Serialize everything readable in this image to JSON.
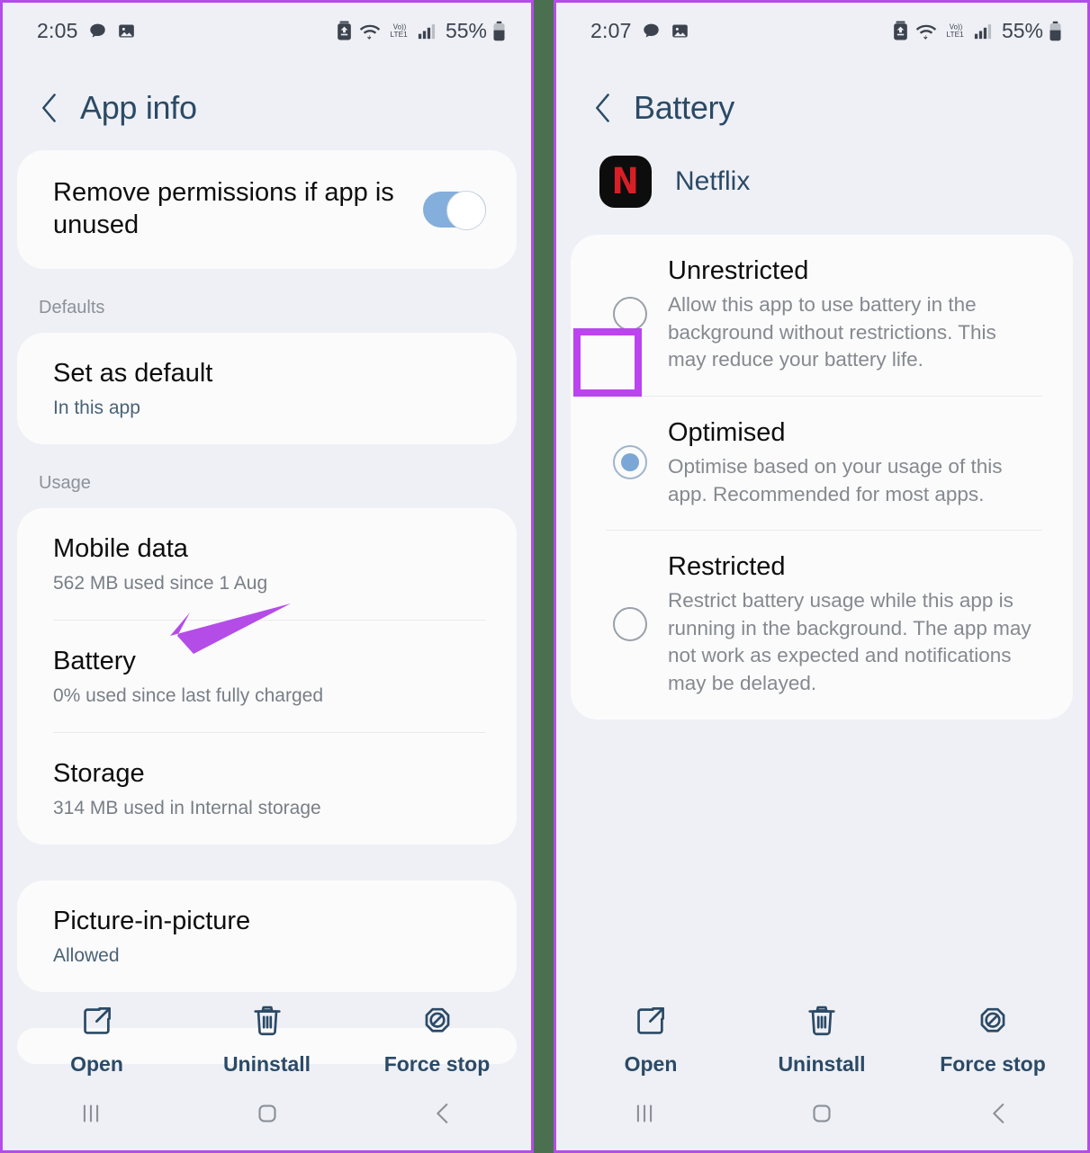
{
  "left_phone": {
    "status_bar": {
      "time": "2:05",
      "battery_percent": "55%",
      "icons": [
        "chat-bubble-icon",
        "image-icon",
        "battery-saver-icon",
        "wifi-icon",
        "volte-lte-icon",
        "signal-bars-icon",
        "battery-icon"
      ]
    },
    "header": {
      "back_label": "back-chevron",
      "title": "App info"
    },
    "permissions_card": {
      "title": "Remove permissions if app is unused",
      "toggle_state": "on"
    },
    "defaults_group_label": "Defaults",
    "defaults_card": {
      "title": "Set as default",
      "subtitle": "In this app"
    },
    "usage_group_label": "Usage",
    "usage_rows": [
      {
        "title": "Mobile data",
        "subtitle": "562 MB used since 1 Aug"
      },
      {
        "title": "Battery",
        "subtitle": "0% used since last fully charged"
      },
      {
        "title": "Storage",
        "subtitle": "314 MB used in Internal storage"
      }
    ],
    "pip_card": {
      "title": "Picture-in-picture",
      "subtitle": "Allowed"
    },
    "actions": [
      {
        "label": "Open",
        "icon": "open-external-icon"
      },
      {
        "label": "Uninstall",
        "icon": "trash-icon"
      },
      {
        "label": "Force stop",
        "icon": "force-stop-icon"
      }
    ],
    "nav": [
      {
        "name": "recents-button",
        "icon": "recents-icon"
      },
      {
        "name": "home-button",
        "icon": "home-icon"
      },
      {
        "name": "back-button",
        "icon": "back-icon"
      }
    ]
  },
  "right_phone": {
    "status_bar": {
      "time": "2:07",
      "battery_percent": "55%"
    },
    "header": {
      "title": "Battery"
    },
    "app": {
      "name": "Netflix",
      "icon_letter": "N",
      "icon_bg": "#0d0d0d",
      "icon_fg": "#d81f26"
    },
    "options": [
      {
        "title": "Unrestricted",
        "description": "Allow this app to use battery in the background without restrictions. This may reduce your battery life.",
        "selected": false,
        "highlighted": true
      },
      {
        "title": "Optimised",
        "description": "Optimise based on your usage of this app. Recommended for most apps.",
        "selected": true,
        "highlighted": false
      },
      {
        "title": "Restricted",
        "description": "Restrict battery usage while this app is running in the background. The app may not work as expected and notifications may be delayed.",
        "selected": false,
        "highlighted": false
      }
    ],
    "actions": [
      {
        "label": "Open",
        "icon": "open-external-icon"
      },
      {
        "label": "Uninstall",
        "icon": "trash-icon"
      },
      {
        "label": "Force stop",
        "icon": "force-stop-icon"
      }
    ]
  },
  "annotations": {
    "arrow_color": "#b44ce8",
    "highlight_color": "#bb44ee",
    "border_color": "#b44ce8",
    "divider_color": "#4a7050"
  }
}
